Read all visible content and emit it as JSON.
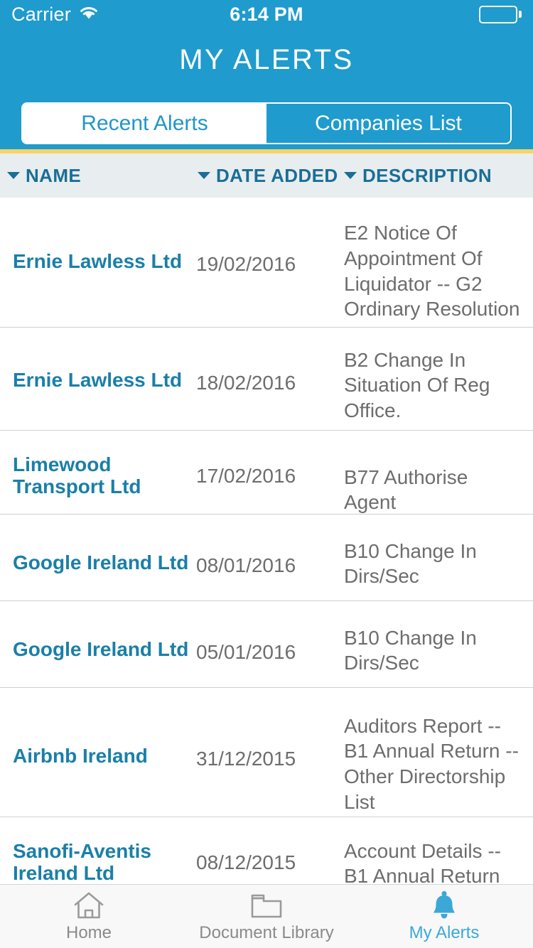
{
  "status_bar": {
    "carrier": "Carrier",
    "wifi_icon": "wifi-icon",
    "time": "6:14 PM",
    "battery_icon": "battery-full-icon"
  },
  "header": {
    "title": "MY ALERTS",
    "background_color": "#1f9bcd",
    "accent_color": "#f7d269",
    "tabs": [
      {
        "label": "Recent Alerts",
        "active": true
      },
      {
        "label": "Companies List",
        "active": false
      }
    ]
  },
  "table": {
    "columns": [
      {
        "label": "NAME",
        "sort_icon": "chevron-down-icon"
      },
      {
        "label": "DATE ADDED",
        "sort_icon": "chevron-down-icon"
      },
      {
        "label": "DESCRIPTION",
        "sort_icon": "chevron-down-icon"
      }
    ],
    "link_color": "#1a7fa8",
    "rows": [
      {
        "name": "Ernie Lawless Ltd",
        "date": "19/02/2016",
        "description": "E2 Notice Of Appointment Of Liquidator -- G2 Ordinary Resolution"
      },
      {
        "name": "Ernie Lawless Ltd",
        "date": "18/02/2016",
        "description": "B2 Change In Situation Of Reg Office."
      },
      {
        "name": "Limewood Transport Ltd",
        "date": "17/02/2016",
        "description": "B77 Authorise Agent"
      },
      {
        "name": "Google Ireland Ltd",
        "date": "08/01/2016",
        "description": "B10 Change In Dirs/Sec"
      },
      {
        "name": "Google Ireland Ltd",
        "date": "05/01/2016",
        "description": "B10 Change In Dirs/Sec"
      },
      {
        "name": "Airbnb Ireland",
        "date": "31/12/2015",
        "description": "Auditors Report -- B1 Annual Return -- Other Directorship List"
      },
      {
        "name": "Sanofi-Aventis Ireland Ltd",
        "date": "08/12/2015",
        "description": "Account Details -- B1 Annual Return"
      }
    ]
  },
  "tab_bar": {
    "items": [
      {
        "label": "Home",
        "icon": "home-icon",
        "active": false
      },
      {
        "label": "Document Library",
        "icon": "folder-icon",
        "active": false
      },
      {
        "label": "My Alerts",
        "icon": "bell-icon",
        "active": true
      }
    ],
    "active_color": "#3ba8d8",
    "inactive_color": "#8a8a8a"
  }
}
